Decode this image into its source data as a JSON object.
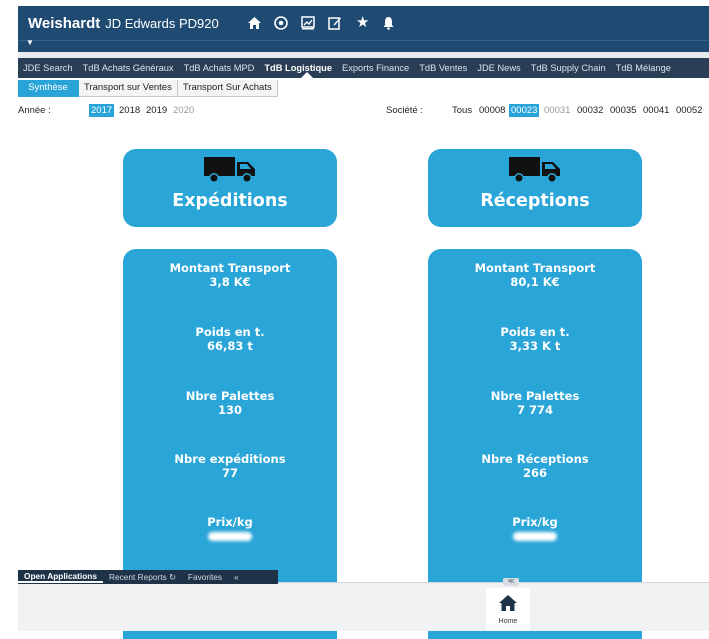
{
  "header": {
    "brand": "Weishardt",
    "product": "JD Edwards PD920",
    "icons": [
      "home-icon",
      "clock-icon",
      "chart-icon",
      "edit-icon",
      "star-icon",
      "bell-icon"
    ]
  },
  "nav": {
    "tabs": [
      {
        "label": "JDE Search",
        "active": false
      },
      {
        "label": "TdB Achats Généraux",
        "active": false
      },
      {
        "label": "TdB Achats MPD",
        "active": false
      },
      {
        "label": "TdB Logistique",
        "active": true
      },
      {
        "label": "Exports Finance",
        "active": false
      },
      {
        "label": "TdB Ventes",
        "active": false
      },
      {
        "label": "JDE News",
        "active": false
      },
      {
        "label": "TdB Supply Chain",
        "active": false
      },
      {
        "label": "TdB Mélange",
        "active": false
      }
    ]
  },
  "subtabs": [
    {
      "label": "Synthèse",
      "active": true
    },
    {
      "label": "Transport sur Ventes",
      "active": false
    },
    {
      "label": "Transport Sur Achats",
      "active": false
    }
  ],
  "filters": {
    "annee_label": "Année :",
    "years": [
      {
        "label": "2017",
        "state": "selected"
      },
      {
        "label": "2018",
        "state": "normal"
      },
      {
        "label": "2019",
        "state": "normal"
      },
      {
        "label": "2020",
        "state": "dim"
      }
    ],
    "societe_label": "Société :",
    "societes": [
      {
        "label": "Tous",
        "state": "normal"
      },
      {
        "label": "00008",
        "state": "normal"
      },
      {
        "label": "00023",
        "state": "selected"
      },
      {
        "label": "00031",
        "state": "dim"
      },
      {
        "label": "00032",
        "state": "normal"
      },
      {
        "label": "00035",
        "state": "normal"
      },
      {
        "label": "00041",
        "state": "normal"
      },
      {
        "label": "00052",
        "state": "normal"
      }
    ]
  },
  "expeditions": {
    "title": "Expéditions",
    "montant_label": "Montant Transport",
    "montant_value": "3,8 K€",
    "poids_label": "Poids en t.",
    "poids_value": "66,83 t",
    "palettes_label": "Nbre Palettes",
    "palettes_value": "130",
    "count_label": "Nbre expéditions",
    "count_value": "77",
    "prix_label": "Prix/kg"
  },
  "receptions": {
    "title": "Réceptions",
    "montant_label": "Montant Transport",
    "montant_value": "80,1 K€",
    "poids_label": "Poids en t.",
    "poids_value": "3,33 K t",
    "palettes_label": "Nbre Palettes",
    "palettes_value": "7 774",
    "count_label": "Nbre Réceptions",
    "count_value": "266",
    "prix_label": "Prix/kg"
  },
  "bottom": {
    "tabs": [
      {
        "label": "Open Applications",
        "active": true
      },
      {
        "label": "Recent Reports",
        "active": false
      },
      {
        "label": "Favorites",
        "active": false
      }
    ],
    "collapse_label": "«",
    "home_label": "Home"
  },
  "colors": {
    "header": "#1f4b73",
    "nav": "#2a3e55",
    "accent": "#29a4d9",
    "card": "#2aa5d8"
  }
}
